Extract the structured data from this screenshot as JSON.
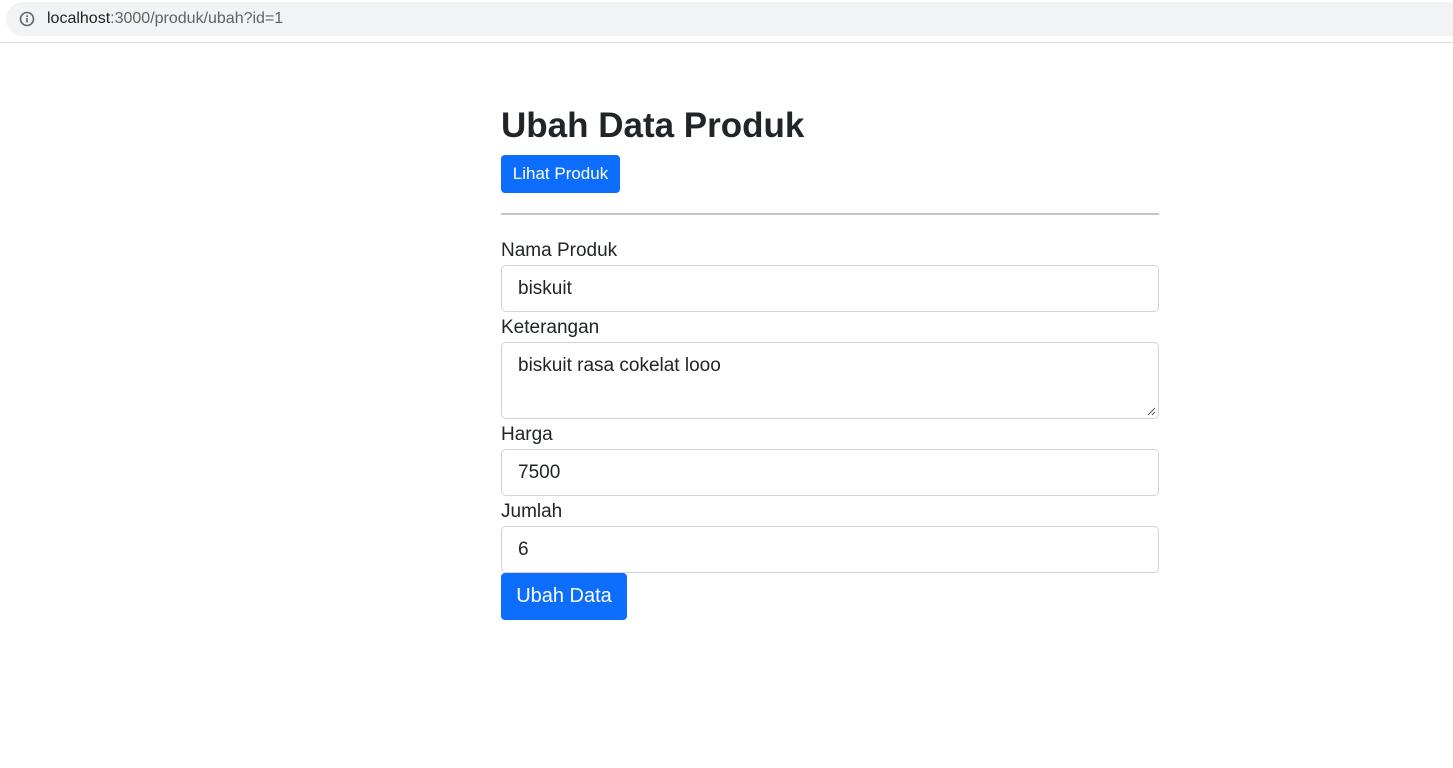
{
  "browser": {
    "url_host": "localhost",
    "url_path": ":3000/produk/ubah?id=1",
    "icon": "info-icon"
  },
  "page": {
    "title": "Ubah Data Produk",
    "view_button_label": "Lihat Produk"
  },
  "form": {
    "name_label": "Nama Produk",
    "name_value": "biskuit",
    "description_label": "Keterangan",
    "description_value": "biskuit rasa cokelat looo",
    "price_label": "Harga",
    "price_value": "7500",
    "quantity_label": "Jumlah",
    "quantity_value": "6",
    "submit_label": "Ubah Data"
  },
  "colors": {
    "primary": "#0d6efd",
    "text": "#212529",
    "border": "#ced4da",
    "address_bar": "#f1f3f4"
  }
}
